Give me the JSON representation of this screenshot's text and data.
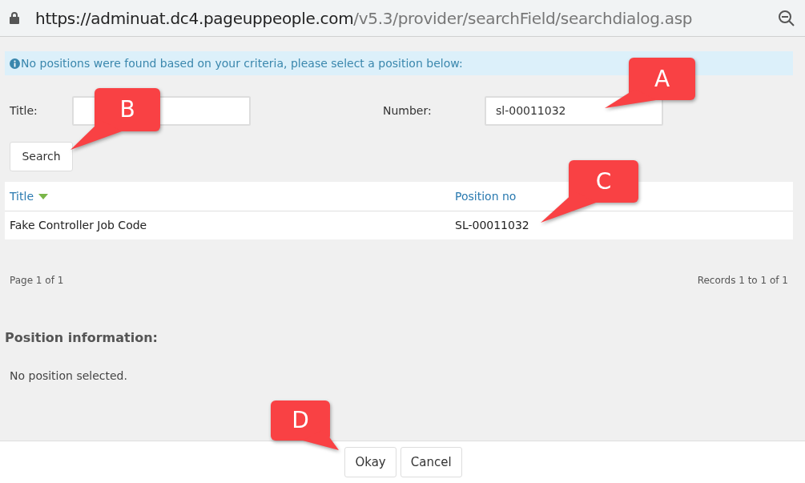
{
  "address_bar": {
    "url_host": "https://adminuat.dc4.pageuppeople.com",
    "url_path": "/v5.3/provider/searchField/searchdialog.asp"
  },
  "info_message": "No positions were found based on your criteria, please select a position below:",
  "search_form": {
    "fields": [
      {
        "label": "Title:"
      },
      {
        "label": "Number:",
        "value": "sl-00011032"
      }
    ],
    "button": "Search"
  },
  "table": {
    "columns": [
      {
        "label": "Title",
        "sorted": true
      },
      {
        "label": "Position no",
        "sorted": false
      }
    ],
    "rows": [
      [
        "Fake Controller Job Code",
        "SL-00011032"
      ]
    ]
  },
  "pagination": {
    "page": "Page 1 of 1",
    "records": "Records 1 to 1 of 1"
  },
  "position_info": {
    "heading": "Position information:",
    "text": "No position selected."
  },
  "footer_buttons": [
    "Okay",
    "Cancel"
  ],
  "callouts": [
    "A",
    "B",
    "C",
    "D"
  ]
}
